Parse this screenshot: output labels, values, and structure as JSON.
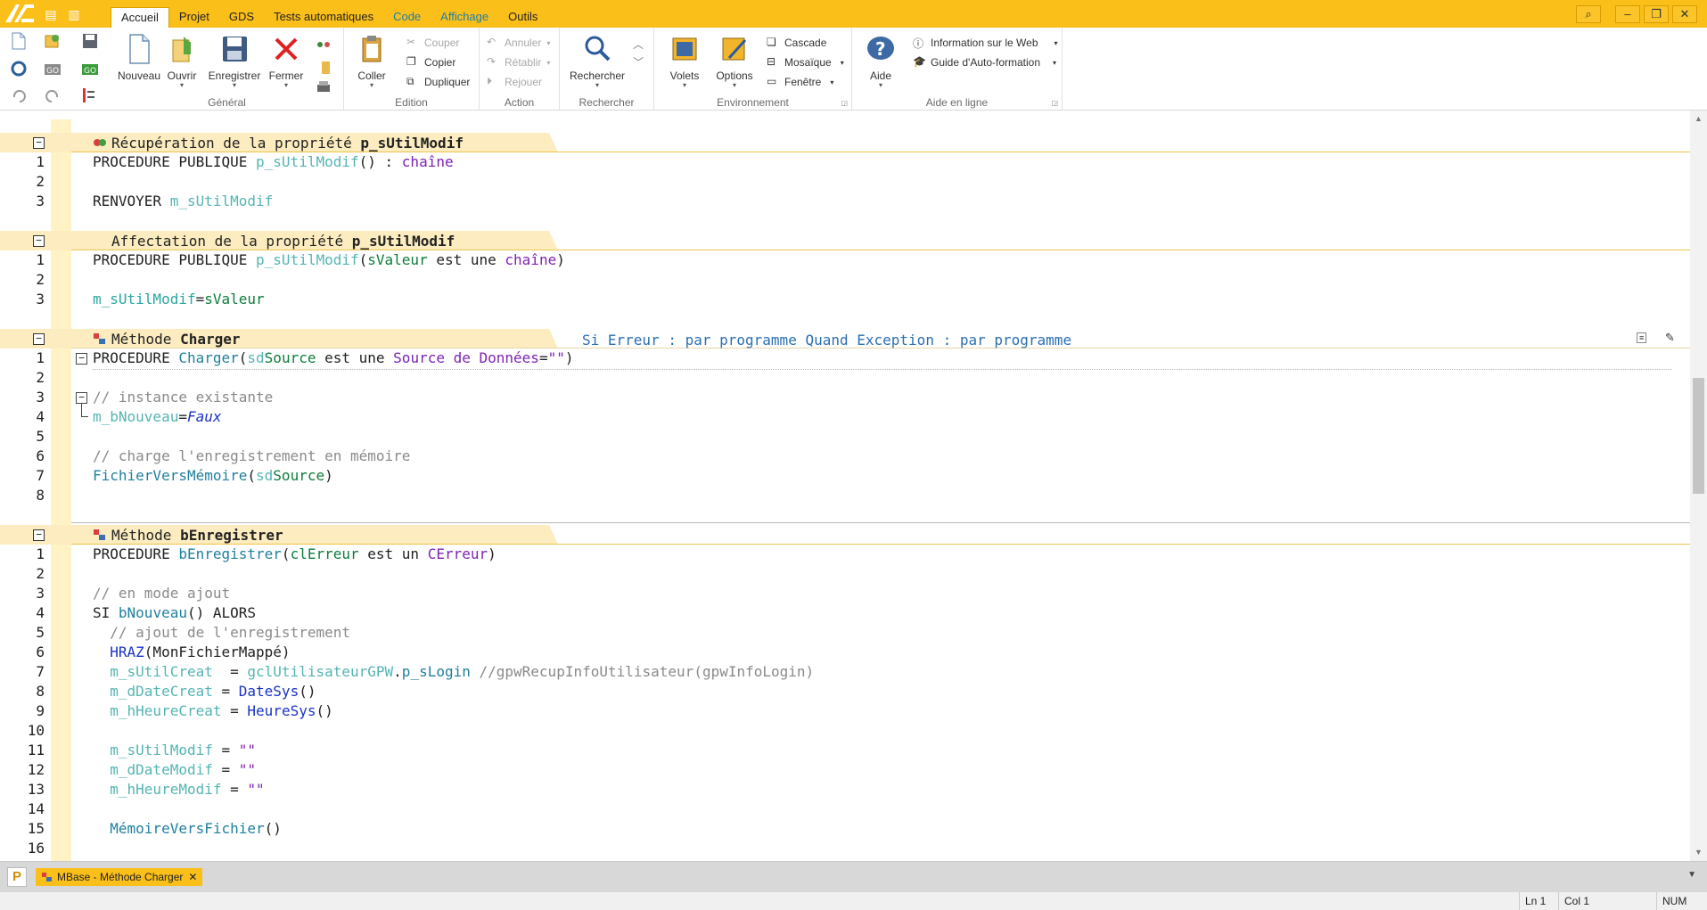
{
  "menu": {
    "tabs": [
      {
        "label": "Accueil",
        "active": true
      },
      {
        "label": "Projet"
      },
      {
        "label": "GDS"
      },
      {
        "label": "Tests automatiques"
      },
      {
        "label": "Code",
        "colored": true
      },
      {
        "label": "Affichage",
        "colored": true
      },
      {
        "label": "Outils"
      }
    ]
  },
  "ribbon": {
    "general": {
      "label": "Général",
      "nouveau": "Nouveau",
      "ouvrir": "Ouvrir",
      "enregistrer": "Enregistrer",
      "fermer": "Fermer"
    },
    "edition": {
      "label": "Edition",
      "coller": "Coller",
      "couper": "Couper",
      "copier": "Copier",
      "dupliquer": "Dupliquer"
    },
    "action": {
      "label": "Action",
      "annuler": "Annuler",
      "retablir": "Rétablir",
      "rejouer": "Rejouer"
    },
    "rechercher": {
      "label": "Rechercher",
      "button": "Rechercher"
    },
    "environnement": {
      "label": "Environnement",
      "volets": "Volets",
      "options": "Options",
      "cascade": "Cascade",
      "mosaique": "Mosaïque",
      "fenetre": "Fenêtre"
    },
    "aide": {
      "label": "Aide en ligne",
      "aide": "Aide",
      "info_web": "Information sur le Web",
      "guide": "Guide d'Auto-formation"
    }
  },
  "editor": {
    "sections": [
      {
        "prefix": "Récupération de la propriété ",
        "name": "p_sUtilModif",
        "extra": ""
      },
      {
        "prefix": "Affectation de la propriété ",
        "name": "p_sUtilModif",
        "extra": ""
      },
      {
        "prefix": "Méthode ",
        "name": "Charger",
        "extra": "Si Erreur : par programme Quand Exception : par programme"
      },
      {
        "prefix": "Méthode ",
        "name": "bEnregistrer",
        "extra": ""
      }
    ],
    "code": {
      "s1l1": [
        "PROCEDURE PUBLIQUE ",
        "p_sUtilModif",
        "() : ",
        "chaîne"
      ],
      "s1l3": [
        "RENVOYER ",
        "m_sUtilModif"
      ],
      "s2l1": [
        "PROCEDURE PUBLIQUE ",
        "p_sUtilModif",
        "(",
        "sValeur",
        " est une ",
        "chaîne",
        ")"
      ],
      "s2l3": [
        "m_sUtilModif",
        "=",
        "sValeur"
      ],
      "s3l1": [
        "PROCEDURE ",
        "Charger",
        "(",
        "sd",
        "Source",
        " est une ",
        "Source de Données",
        "=",
        "\"\"",
        ")"
      ],
      "s3l3": "// instance existante",
      "s3l4": [
        "m_bNouveau",
        "=",
        "Faux"
      ],
      "s3l6": "// charge l'enregistrement en mémoire",
      "s3l7": [
        "FichierVersMémoire",
        "(",
        "sd",
        "Source",
        ")"
      ],
      "s4l1": [
        "PROCEDURE ",
        "bEnregistrer",
        "(",
        "clErreur",
        " est un ",
        "CErreur",
        ")"
      ],
      "s4l3": "// en mode ajout",
      "s4l4": [
        "SI ",
        "bNouveau",
        "() ALORS"
      ],
      "s4l5": "  // ajout de l'enregistrement",
      "s4l6": [
        "  ",
        "HRAZ",
        "(MonFichierMappé)"
      ],
      "s4l7": [
        "  ",
        "m_sUtilCreat",
        "  = ",
        "gclUtilisateurGPW",
        ".",
        "p_sLogin",
        " //gpwRecupInfoUtilisateur(gpwInfoLogin)"
      ],
      "s4l8": [
        "  ",
        "m_dDateCreat",
        " = ",
        "DateSys",
        "()"
      ],
      "s4l9": [
        "  ",
        "m_hHeureCreat",
        " = ",
        "HeureSys",
        "()"
      ],
      "s4l11": [
        "  ",
        "m_sUtilModif",
        " = ",
        "\"\""
      ],
      "s4l12": [
        "  ",
        "m_dDateModif",
        " = ",
        "\"\""
      ],
      "s4l13": [
        "  ",
        "m_hHeureModif",
        " = ",
        "\"\""
      ],
      "s4l15": [
        "  ",
        "MémoireVersFichier",
        "()"
      ]
    }
  },
  "bottom": {
    "project_letter": "P",
    "doc_tab": "MBase - Méthode Charger",
    "close": "✕"
  },
  "status": {
    "ln": "Ln 1",
    "col": "Col 1",
    "num": "NUM"
  },
  "colors": {
    "accent": "#fbbf1a",
    "header_band": "#fcecbf",
    "margin": "#fff3c6"
  }
}
